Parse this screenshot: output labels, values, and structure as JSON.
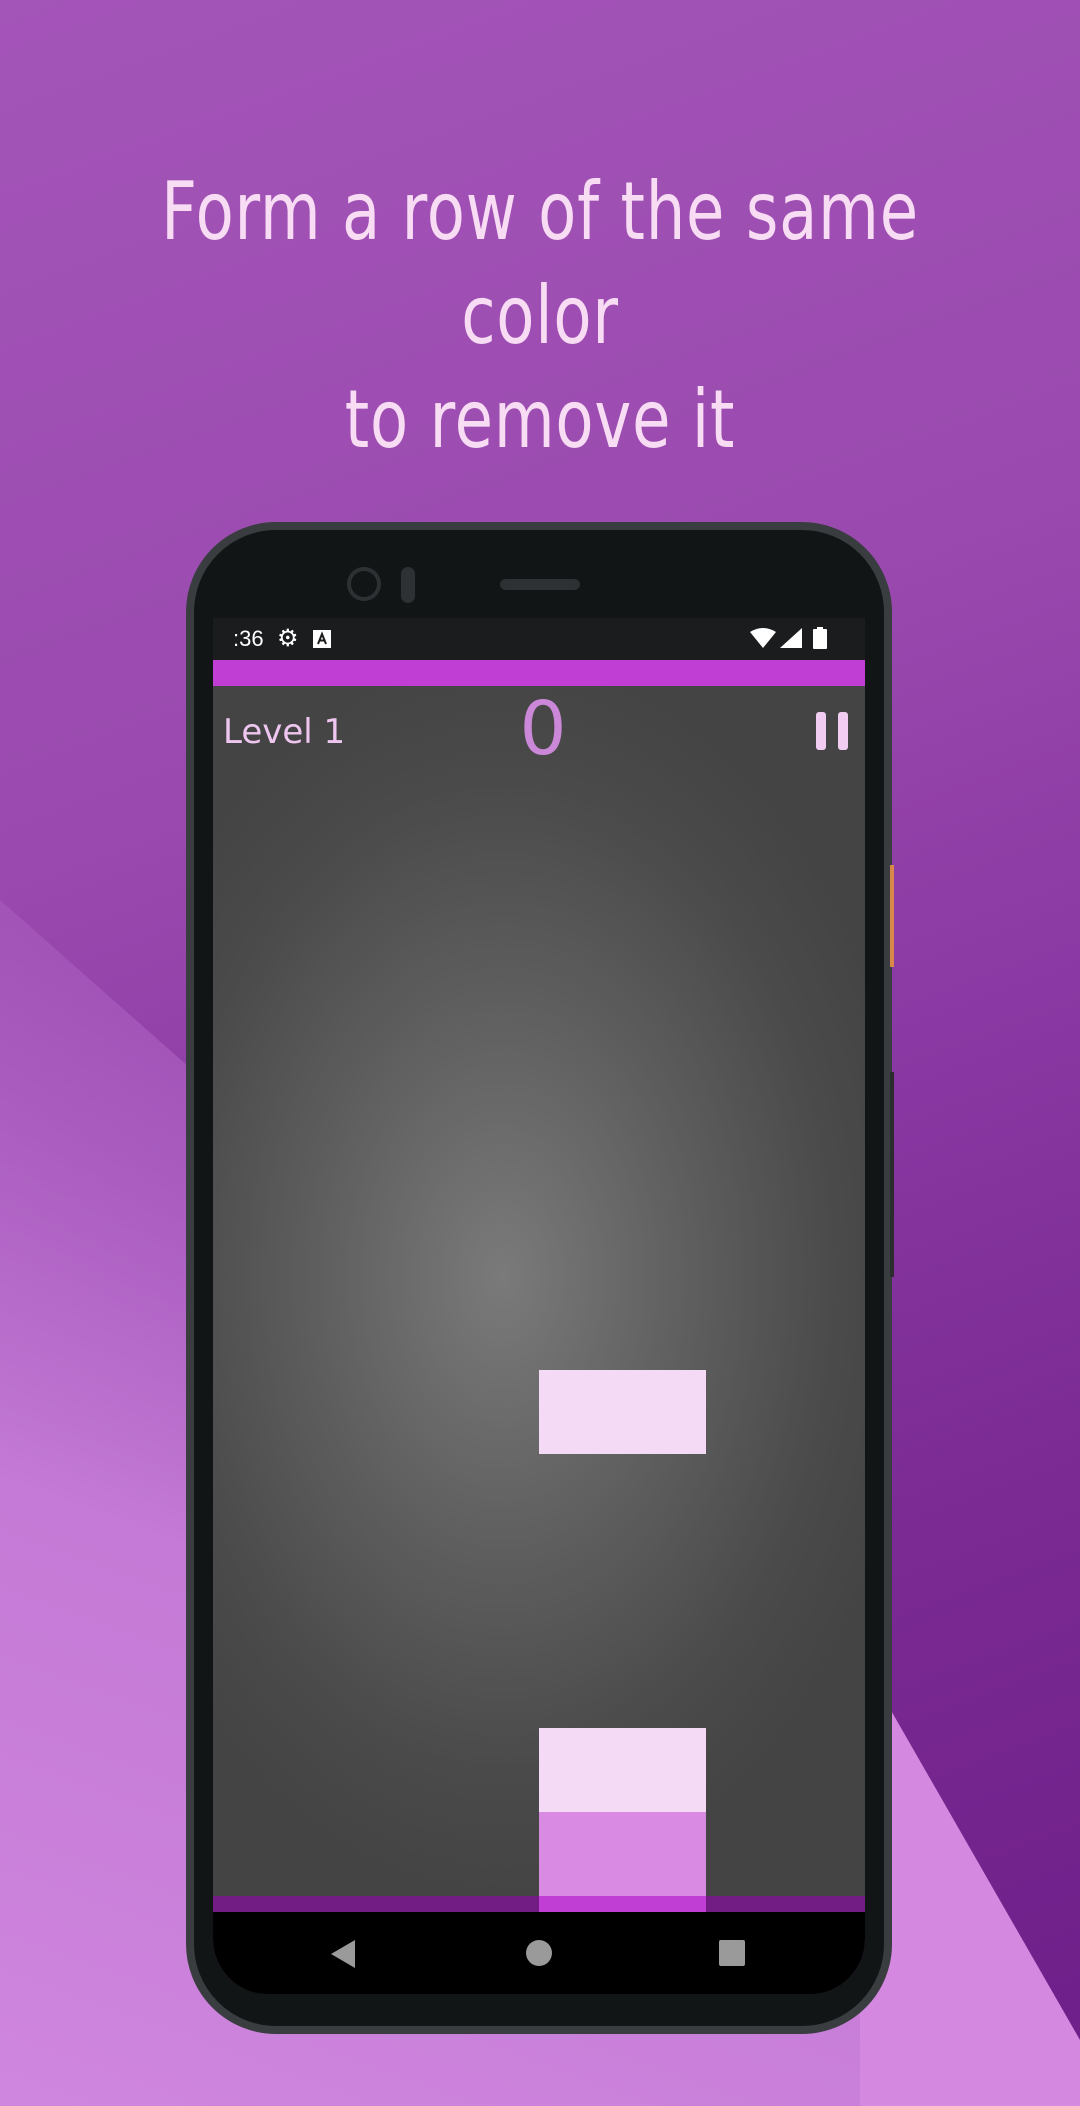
{
  "headline": {
    "line1": "Form a row of the same color",
    "line2": "to remove it"
  },
  "status_bar": {
    "time": ":36",
    "icons": [
      "gear-icon",
      "a-icon",
      "wifi-icon",
      "signal-icon",
      "battery-icon"
    ]
  },
  "game": {
    "level_label": "Level 1",
    "score": "0",
    "pause_icon": "pause-icon",
    "falling_block_color": "#f5daf5",
    "stack_block_colors": [
      "#f5daf5",
      "#d98ae3",
      "#c03ed4"
    ],
    "floor_color": "#711d84",
    "accent_color": "#c03ed4"
  },
  "navigation": {
    "icons": [
      "back-icon",
      "home-icon",
      "recents-icon"
    ]
  }
}
